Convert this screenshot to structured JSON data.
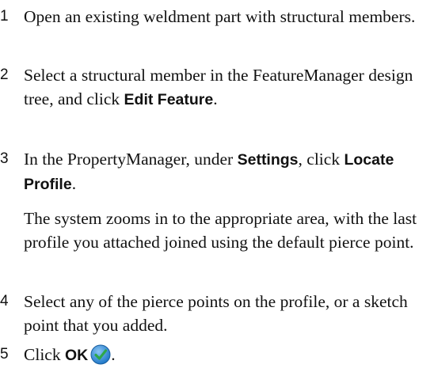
{
  "steps": [
    {
      "num": "1",
      "t1": "Open an existing weldment part with structural members."
    },
    {
      "num": "2",
      "t1": "Select a structural member in the FeatureManager design tree, and click ",
      "b1": "Edit Feature",
      "t2": "."
    },
    {
      "num": "3",
      "t1": "In the PropertyManager, under ",
      "b1": "Settings",
      "t2": ", click ",
      "b2": "Locate Profile",
      "t3": "."
    },
    {
      "num": "4",
      "t1": "Select any of the pierce points on the profile, or a sketch point that you added."
    },
    {
      "num": "5",
      "t1": "Click ",
      "b1": "OK",
      "t2": "."
    }
  ],
  "note": "The system zooms in to the appropriate area, with the last profile you attached joined using the default pierce point.",
  "ok_icon": "ok-checkmark-icon",
  "colors": {
    "text": "#111111",
    "ok_fill": "#1f78c8",
    "ok_check": "#2ea84a"
  }
}
